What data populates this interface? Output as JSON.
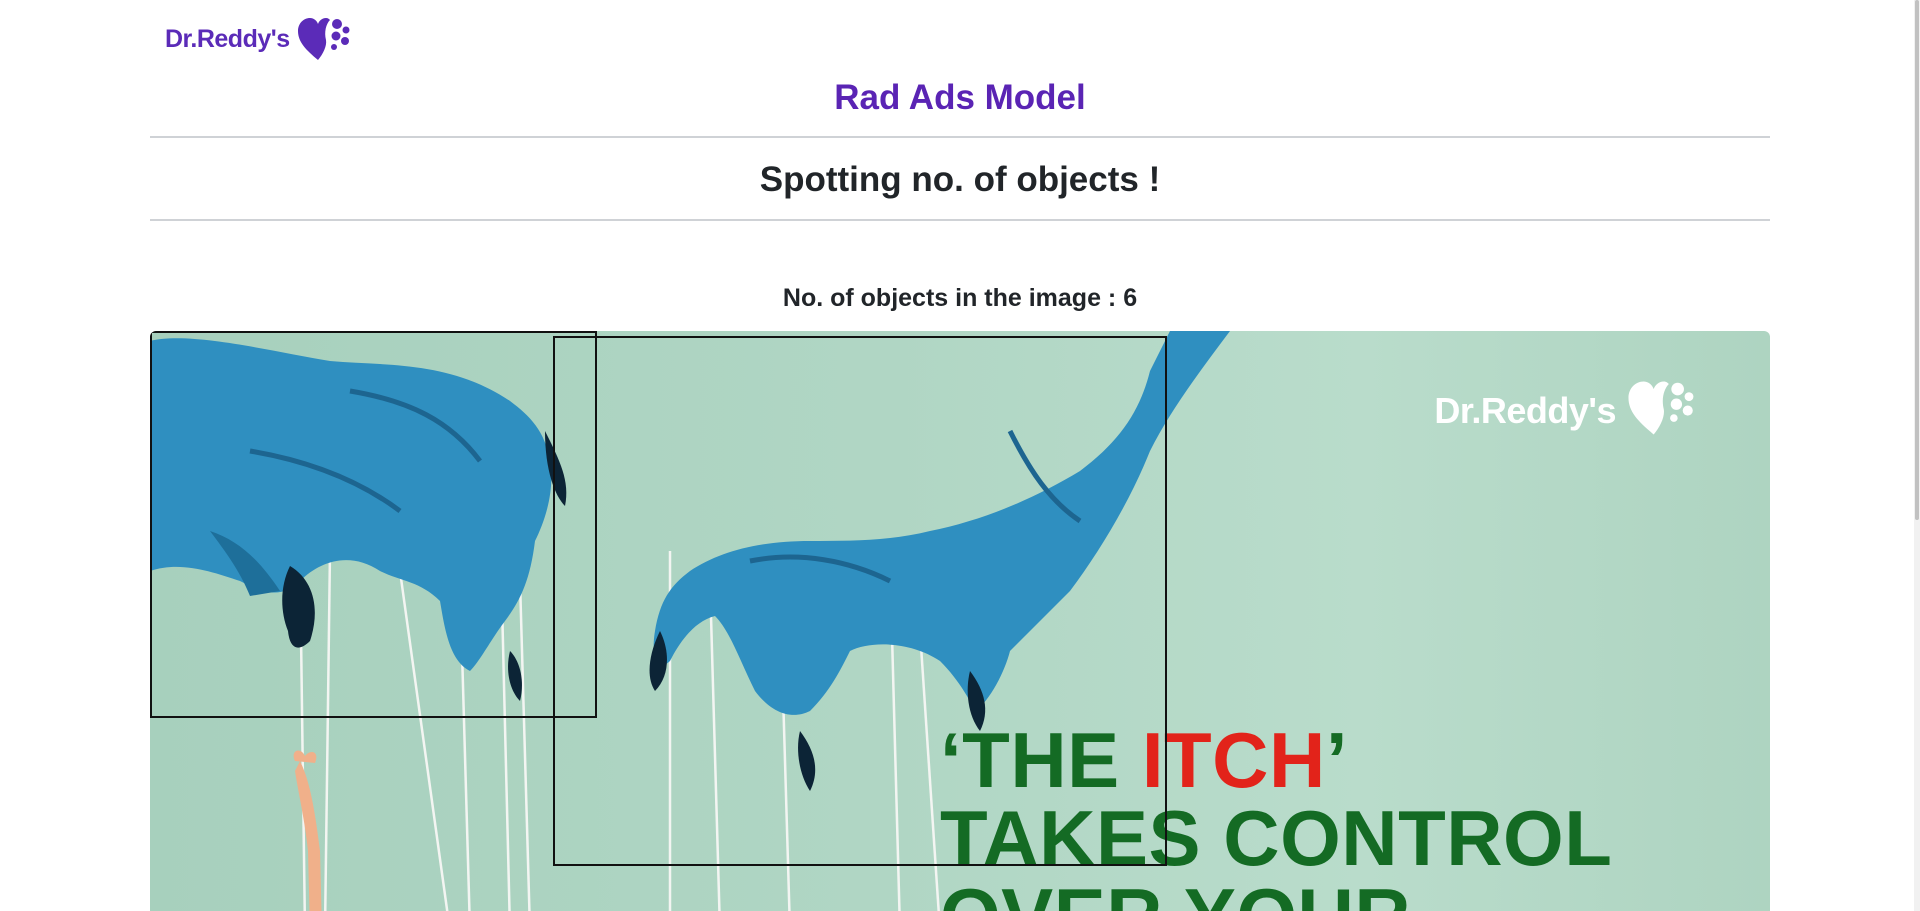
{
  "brand": {
    "name": "Dr.Reddy's",
    "color": "#5b2bb8"
  },
  "header": {
    "title": "Rad Ads Model",
    "title_color": "#5a24b4"
  },
  "section": {
    "title": "Spotting no. of objects !"
  },
  "result": {
    "label": "No. of objects in the image",
    "separator": " : ",
    "count": "6"
  },
  "ad": {
    "logo_text": "Dr.Reddy's",
    "headline_part1": "‘THE ",
    "headline_red": "ITCH",
    "headline_part2": "’",
    "headline_line2": "TAKES CONTROL",
    "headline_line3": "OVER YOUR",
    "headline_color": "#146b24",
    "accent_red": "#e2231a",
    "hand_color": "#2f8fc0"
  }
}
